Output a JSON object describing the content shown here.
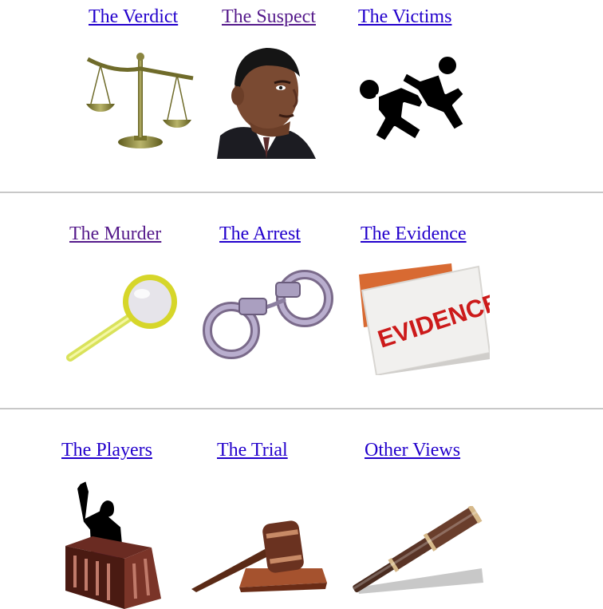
{
  "rows": [
    {
      "items": [
        {
          "label": "The Verdict",
          "icon": "scales-of-justice-icon",
          "state": "unvisited"
        },
        {
          "label": "The Suspect",
          "icon": "suspect-portrait-icon",
          "state": "visited"
        },
        {
          "label": "The Victims",
          "icon": "chalk-outline-icon",
          "state": "unvisited"
        }
      ]
    },
    {
      "items": [
        {
          "label": "The Murder",
          "icon": "magnifying-glass-icon",
          "state": "visited"
        },
        {
          "label": "The Arrest",
          "icon": "handcuffs-icon",
          "state": "unvisited"
        },
        {
          "label": "The Evidence",
          "icon": "evidence-card-icon",
          "state": "unvisited"
        }
      ]
    },
    {
      "items": [
        {
          "label": "The Players",
          "icon": "witness-stand-icon",
          "state": "unvisited"
        },
        {
          "label": "The Trial",
          "icon": "gavel-icon",
          "state": "unvisited"
        },
        {
          "label": "Other Views",
          "icon": "spyglass-icon",
          "state": "unvisited"
        }
      ]
    }
  ],
  "evidence_card_text": "EVIDENCE",
  "colors": {
    "link_unvisited": "#2200cc",
    "link_visited": "#551a8b",
    "divider": "#c8c8c8",
    "background": "#ffffff"
  }
}
